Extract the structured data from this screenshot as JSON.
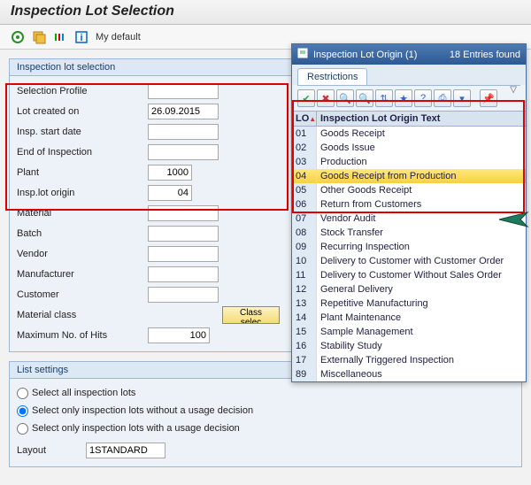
{
  "title": "Inspection Lot Selection",
  "toolbar": {
    "default_label": "My default"
  },
  "group1": {
    "title": "Inspection lot selection",
    "rows": {
      "sel_profile": "Selection Profile",
      "lot_created": "Lot created on",
      "lot_created_val": "26.09.2015",
      "insp_start": "Insp. start date",
      "end_insp": "End of Inspection",
      "plant": "Plant",
      "plant_val": "1000",
      "origin": "Insp.lot origin",
      "origin_val": "04",
      "material": "Material",
      "batch": "Batch",
      "vendor": "Vendor",
      "manufacturer": "Manufacturer",
      "customer": "Customer",
      "mat_class": "Material class",
      "class_sel_btn": "Class selec",
      "max_hits": "Maximum No. of Hits",
      "max_hits_val": "100"
    }
  },
  "group2": {
    "title": "List settings",
    "opt1": "Select all inspection lots",
    "opt2": "Select only inspection lots without a usage decision",
    "opt3": "Select only inspection lots with a usage decision",
    "layout_label": "Layout",
    "layout_val": "1STANDARD"
  },
  "popup": {
    "title_a": "Inspection Lot Origin (1)",
    "title_b": "18 Entries found",
    "tab": "Restrictions",
    "col1": "LO",
    "col2": "Inspection Lot Origin Text",
    "rows": [
      {
        "code": "01",
        "text": "Goods Receipt"
      },
      {
        "code": "02",
        "text": "Goods Issue"
      },
      {
        "code": "03",
        "text": "Production"
      },
      {
        "code": "04",
        "text": "Goods Receipt from Production"
      },
      {
        "code": "05",
        "text": "Other Goods Receipt"
      },
      {
        "code": "06",
        "text": "Return from Customers"
      },
      {
        "code": "07",
        "text": "Vendor Audit"
      },
      {
        "code": "08",
        "text": "Stock Transfer"
      },
      {
        "code": "09",
        "text": "Recurring Inspection"
      },
      {
        "code": "10",
        "text": "Delivery to Customer with Customer Order"
      },
      {
        "code": "11",
        "text": "Delivery to Customer Without Sales Order"
      },
      {
        "code": "12",
        "text": "General Delivery"
      },
      {
        "code": "13",
        "text": "Repetitive Manufacturing"
      },
      {
        "code": "14",
        "text": "Plant Maintenance"
      },
      {
        "code": "15",
        "text": "Sample Management"
      },
      {
        "code": "16",
        "text": "Stability Study"
      },
      {
        "code": "17",
        "text": "Externally Triggered Inspection"
      },
      {
        "code": "89",
        "text": "Miscellaneous"
      }
    ]
  }
}
